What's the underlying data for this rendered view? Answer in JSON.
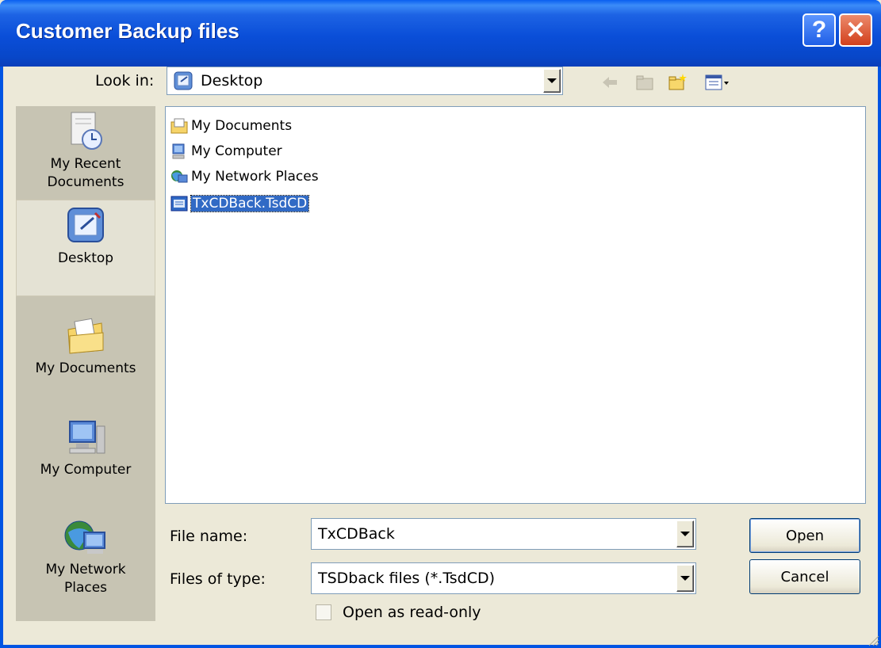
{
  "window": {
    "title": "Customer Backup files",
    "help_label": "?",
    "close_label": "✕"
  },
  "look_in": {
    "label": "Look in:",
    "value": "Desktop"
  },
  "toolbar": {
    "icons": [
      "back-arrow-icon",
      "up-folder-icon",
      "new-folder-icon",
      "view-menu-icon"
    ]
  },
  "places": [
    {
      "label": "My Recent Documents",
      "line1": "My Recent",
      "line2": "Documents",
      "icon": "recent-documents-icon"
    },
    {
      "label": "Desktop",
      "line1": "Desktop",
      "line2": "",
      "icon": "desktop-icon",
      "active": true
    },
    {
      "label": "My Documents",
      "line1": "My Documents",
      "line2": "",
      "icon": "my-documents-icon"
    },
    {
      "label": "My Computer",
      "line1": "My Computer",
      "line2": "",
      "icon": "my-computer-icon"
    },
    {
      "label": "My Network Places",
      "line1": "My Network",
      "line2": "Places",
      "icon": "network-places-icon"
    }
  ],
  "files": [
    {
      "name": "My Documents",
      "icon": "folder-documents-icon"
    },
    {
      "name": "My Computer",
      "icon": "computer-icon"
    },
    {
      "name": "My Network Places",
      "icon": "network-icon"
    },
    {
      "name": "TxCDBack.TsdCD",
      "icon": "file-icon",
      "selected": true
    }
  ],
  "file_name": {
    "label": "File name:",
    "value": "TxCDBack"
  },
  "file_type": {
    "label": "Files of type:",
    "value": "TSDback files (*.TsdCD)"
  },
  "read_only": {
    "label": "Open as read-only",
    "checked": false
  },
  "buttons": {
    "open": "Open",
    "cancel": "Cancel"
  },
  "colors": {
    "title_bar": "#0a4ed8",
    "selection": "#316ac5",
    "dialog_bg": "#ece9d8"
  }
}
